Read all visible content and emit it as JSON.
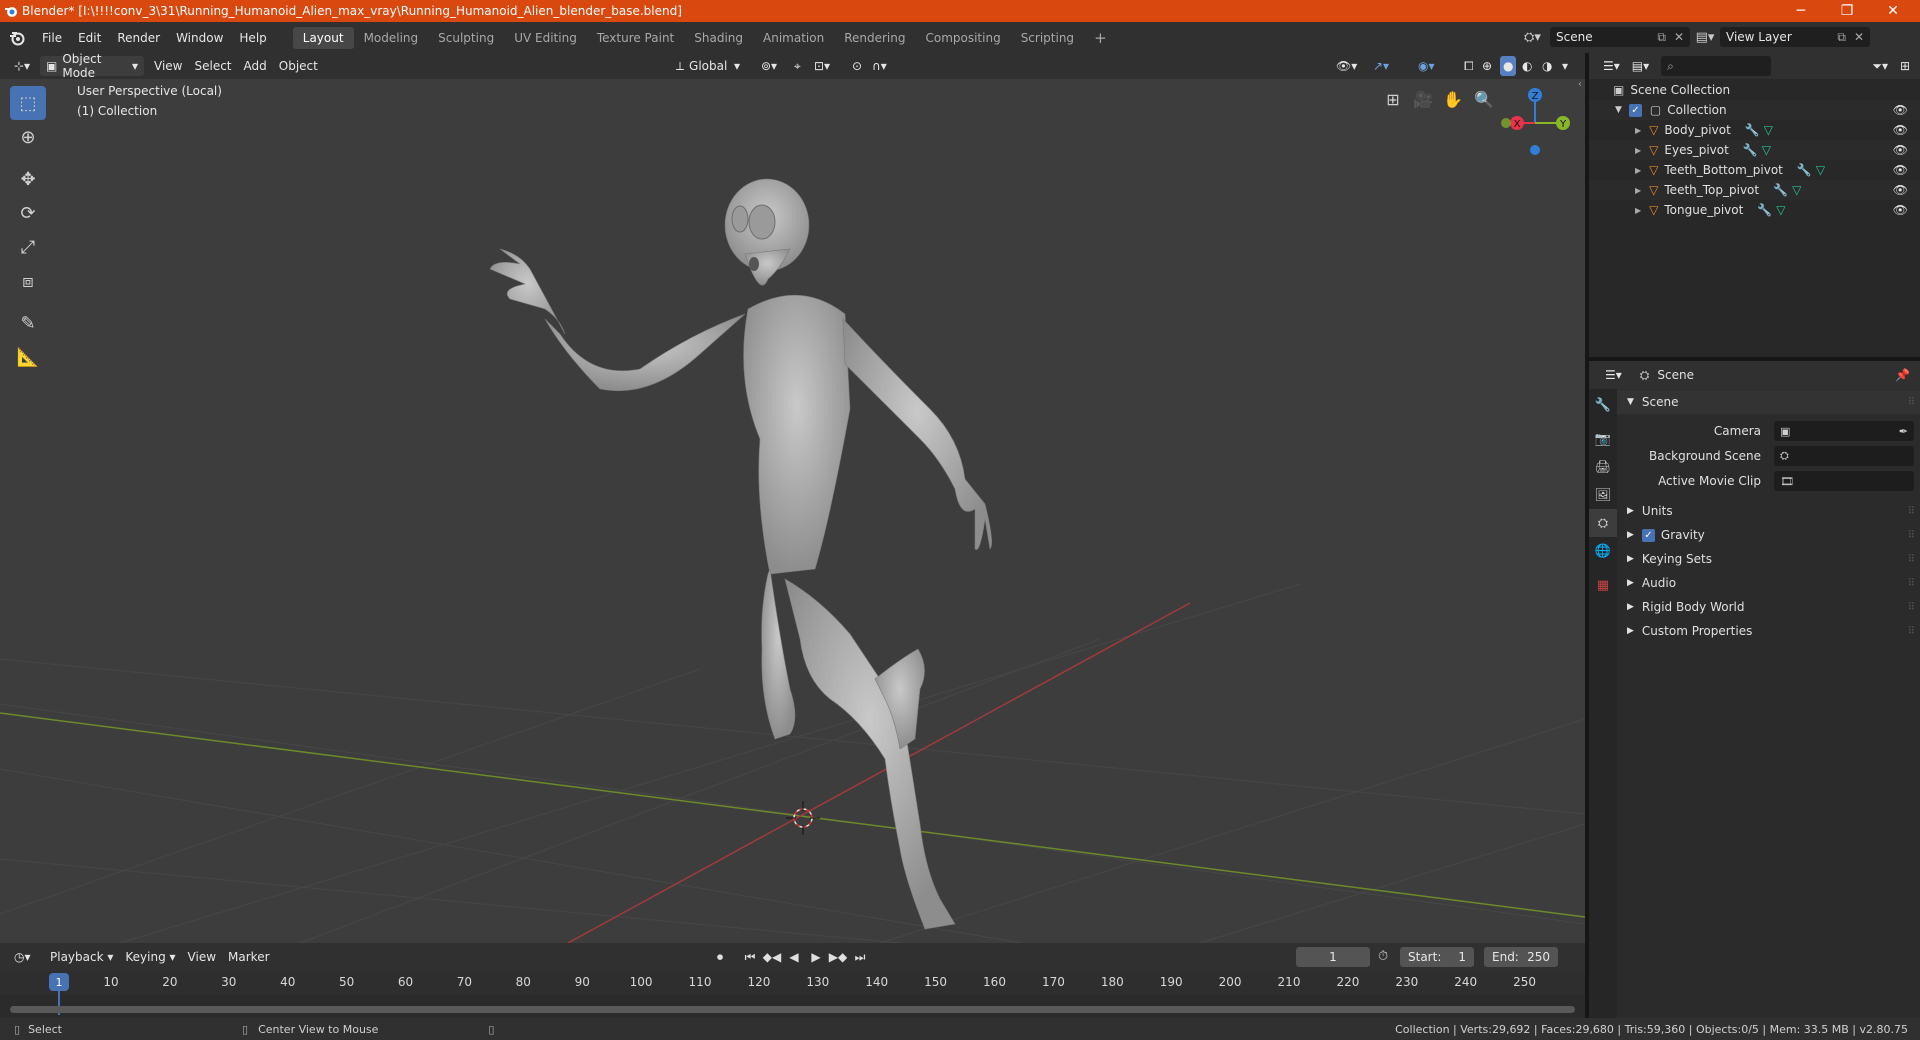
{
  "window": {
    "title": "Blender* [I:\\!!!!conv_3\\31\\Running_Humanoid_Alien_max_vray\\Running_Humanoid_Alien_blender_base.blend]",
    "minimize": "─",
    "maximize": "❐",
    "close": "✕"
  },
  "menu": {
    "items": [
      "File",
      "Edit",
      "Render",
      "Window",
      "Help"
    ]
  },
  "workspaces": {
    "tabs": [
      "Layout",
      "Modeling",
      "Sculpting",
      "UV Editing",
      "Texture Paint",
      "Shading",
      "Animation",
      "Rendering",
      "Compositing",
      "Scripting"
    ],
    "active": "Layout",
    "add": "+"
  },
  "scene_selector": {
    "value": "Scene"
  },
  "view_layer_selector": {
    "value": "View Layer"
  },
  "viewport_header": {
    "mode": "Object Mode",
    "menus": [
      "View",
      "Select",
      "Add",
      "Object"
    ],
    "orientation": "Global"
  },
  "viewport": {
    "perspective_label": "User Perspective (Local)",
    "collection_label": "(1) Collection",
    "gizmo": {
      "x": "X",
      "y": "Y",
      "z": "Z"
    }
  },
  "outliner": {
    "root": "Scene Collection",
    "collection": "Collection",
    "objects": [
      "Body_pivot",
      "Eyes_pivot",
      "Teeth_Bottom_pivot",
      "Teeth_Top_pivot",
      "Tongue_pivot"
    ]
  },
  "properties": {
    "header": "Scene",
    "panel_title": "Scene",
    "fields": [
      {
        "label": "Camera",
        "value": ""
      },
      {
        "label": "Background Scene",
        "value": ""
      },
      {
        "label": "Active Movie Clip",
        "value": ""
      }
    ],
    "sections": [
      "Units",
      "Gravity",
      "Keying Sets",
      "Audio",
      "Rigid Body World",
      "Custom Properties"
    ],
    "gravity_checked": true
  },
  "timeline": {
    "menus": [
      "Playback",
      "Keying",
      "View",
      "Marker"
    ],
    "current_frame": "1",
    "start_label": "Start:",
    "start": "1",
    "end_label": "End:",
    "end": "250",
    "ruler_labels": [
      "1",
      "10",
      "20",
      "30",
      "40",
      "50",
      "60",
      "70",
      "80",
      "90",
      "100",
      "110",
      "120",
      "130",
      "140",
      "150",
      "160",
      "170",
      "180",
      "190",
      "200",
      "210",
      "220",
      "230",
      "240",
      "250"
    ]
  },
  "statusbar": {
    "select": "Select",
    "center_view": "Center View to Mouse",
    "stats": "Collection | Verts:29,692 | Faces:29,680 | Tris:59,360 | Objects:0/5 | Mem: 33.5 MB | v2.80.75"
  },
  "colors": {
    "titlebar": "#d9480f",
    "accent": "#4772b3",
    "object_icon": "#e6852d",
    "modifier_icon": "#5aa0e0",
    "mesh_icon": "#26c49a",
    "axis_x": "#e8334a",
    "axis_y": "#88b82a",
    "axis_z": "#2f7fd8"
  }
}
